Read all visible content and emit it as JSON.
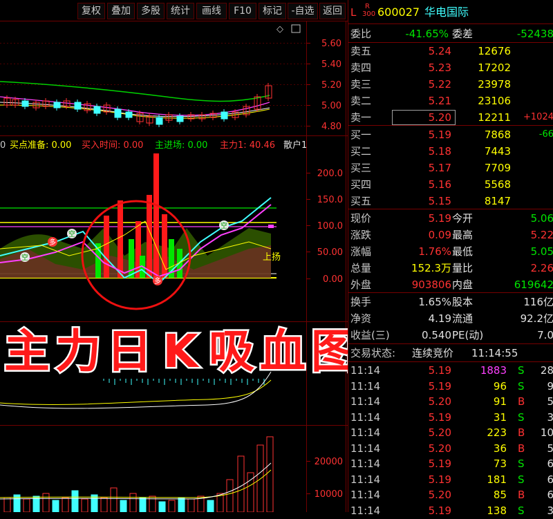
{
  "toolbar": {
    "buttons": [
      "复权",
      "叠加",
      "多股",
      "统计",
      "画线",
      "F10",
      "标记",
      "-自选",
      "返回"
    ]
  },
  "stock": {
    "market_prefix": "L",
    "rank_top": "R",
    "rank_bottom": "300",
    "code": "600027",
    "name": "华电国际"
  },
  "price_axis": [
    "5.60",
    "5.40",
    "5.20",
    "5.00",
    "4.80"
  ],
  "indicator_header": [
    {
      "text": "0",
      "color": "#c8c8c8"
    },
    {
      "text": "买点准备: 0.00",
      "color": "#ffff00"
    },
    {
      "text": "买入时间: 0.00",
      "color": "#ff3232"
    },
    {
      "text": "主进场: 0.00",
      "color": "#00e600"
    },
    {
      "text": "主力1: 40.46",
      "color": "#ff3232"
    },
    {
      "text": "散户1",
      "color": "#e0e0e0"
    }
  ],
  "indicator_axis": [
    "200.0",
    "150.0",
    "100.0",
    "50.00",
    "0.00"
  ],
  "indicator_labels": {
    "kong": "空",
    "duo": "多",
    "shang_yang": "上扬",
    "kong_small": "空"
  },
  "volume_axis": [
    "20000",
    "10000"
  ],
  "banner": {
    "text": "主力日K吸血图"
  },
  "order_book": {
    "weibi_label": "委比",
    "weibi_value": "-41.65%",
    "weicha_label": "委差",
    "weicha_value": "-52438",
    "sell": [
      {
        "label": "卖五",
        "price": "5.24",
        "vol": "12676",
        "extra": ""
      },
      {
        "label": "卖四",
        "price": "5.23",
        "vol": "17202",
        "extra": ""
      },
      {
        "label": "卖三",
        "price": "5.22",
        "vol": "23978",
        "extra": ""
      },
      {
        "label": "卖二",
        "price": "5.21",
        "vol": "23106",
        "extra": ""
      },
      {
        "label": "卖一",
        "price": "5.20",
        "vol": "12211",
        "extra": "+1024"
      }
    ],
    "buy": [
      {
        "label": "买一",
        "price": "5.19",
        "vol": "7868",
        "extra": "-66"
      },
      {
        "label": "买二",
        "price": "5.18",
        "vol": "7443",
        "extra": ""
      },
      {
        "label": "买三",
        "price": "5.17",
        "vol": "7709",
        "extra": ""
      },
      {
        "label": "买四",
        "price": "5.16",
        "vol": "5568",
        "extra": ""
      },
      {
        "label": "买五",
        "price": "5.15",
        "vol": "8147",
        "extra": ""
      }
    ]
  },
  "quote": [
    {
      "l1": "现价",
      "v1": "5.19",
      "c1": "#ff3232",
      "l2": "今开",
      "v2": "5.06",
      "c2": "#00e600"
    },
    {
      "l1": "涨跌",
      "v1": "0.09",
      "c1": "#ff3232",
      "l2": "最高",
      "v2": "5.22",
      "c2": "#ff3232"
    },
    {
      "l1": "涨幅",
      "v1": "1.76%",
      "c1": "#ff3232",
      "l2": "最低",
      "v2": "5.05",
      "c2": "#00e600"
    },
    {
      "l1": "总量",
      "v1": "152.3万",
      "c1": "#ffff00",
      "l2": "量比",
      "v2": "2.26",
      "c2": "#ff3232"
    },
    {
      "l1": "外盘",
      "v1": "903806",
      "c1": "#ff3232",
      "l2": "内盘",
      "v2": "619642",
      "c2": "#00e600"
    }
  ],
  "quote2": [
    {
      "l1": "换手",
      "v1": "1.65%",
      "l2": "股本",
      "v2": "116亿"
    },
    {
      "l1": "净资",
      "v1": "4.19",
      "l2": "流通",
      "v2": "92.2亿"
    },
    {
      "l1": "收益(三)",
      "v1": "0.540",
      "l2": "PE(动)",
      "v2": "7.0"
    }
  ],
  "trade_status": {
    "label": "交易状态:",
    "value": "连续竞价",
    "time": "11:14:55"
  },
  "ticks": [
    {
      "time": "11:14",
      "price": "5.19",
      "vol": "1883",
      "side": "S",
      "n": "28",
      "vc": "#ff40ff"
    },
    {
      "time": "11:14",
      "price": "5.19",
      "vol": "96",
      "side": "S",
      "n": "9",
      "vc": "#ffff00"
    },
    {
      "time": "11:14",
      "price": "5.20",
      "vol": "91",
      "side": "B",
      "n": "5",
      "vc": "#ffff00"
    },
    {
      "time": "11:14",
      "price": "5.19",
      "vol": "31",
      "side": "S",
      "n": "3",
      "vc": "#ffff00"
    },
    {
      "time": "11:14",
      "price": "5.20",
      "vol": "223",
      "side": "B",
      "n": "10",
      "vc": "#ffff00"
    },
    {
      "time": "11:14",
      "price": "5.20",
      "vol": "36",
      "side": "B",
      "n": "5",
      "vc": "#ffff00"
    },
    {
      "time": "11:14",
      "price": "5.19",
      "vol": "73",
      "side": "S",
      "n": "6",
      "vc": "#ffff00"
    },
    {
      "time": "11:14",
      "price": "5.19",
      "vol": "181",
      "side": "S",
      "n": "6",
      "vc": "#ffff00"
    },
    {
      "time": "11:14",
      "price": "5.20",
      "vol": "85",
      "side": "B",
      "n": "6",
      "vc": "#ffff00"
    },
    {
      "time": "11:14",
      "price": "5.19",
      "vol": "138",
      "side": "S",
      "n": "3",
      "vc": "#ffff00"
    }
  ],
  "colors": {
    "up": "#ff3232",
    "down": "#00e600",
    "cyan": "#40ffff",
    "yellow": "#ffff00",
    "frame": "#700000"
  }
}
